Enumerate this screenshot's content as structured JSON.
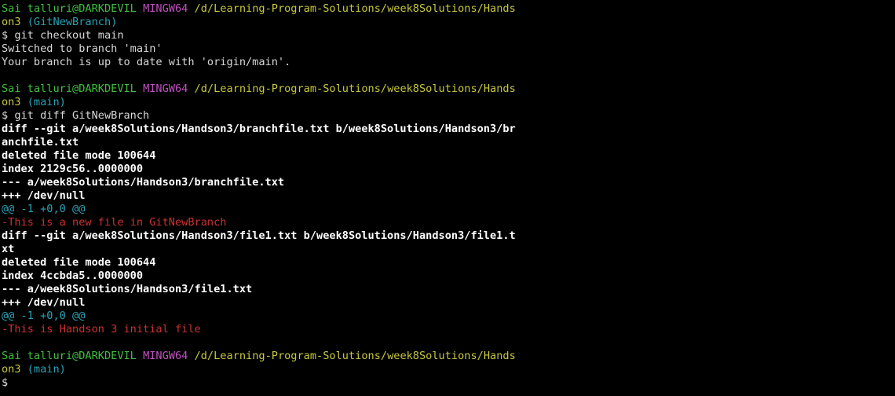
{
  "prompt": {
    "user_host": "Sai talluri@DARKDEVIL",
    "shell": "MINGW64",
    "path_part1": "/d/Learning-Program-Solutions/week8Solutions/Hands",
    "path_part2": "on3"
  },
  "blocks": {
    "b1": {
      "branch": "(GitNewBranch)",
      "command": "$ git checkout main",
      "out1": "Switched to branch 'main'",
      "out2": "Your branch is up to date with 'origin/main'."
    },
    "b2": {
      "branch": "(main)",
      "command": "$ git diff GitNewBranch",
      "diff1_header_a": "diff --git a/week8Solutions/Handson3/branchfile.txt b/week8Solutions/Handson3/br",
      "diff1_header_b": "anchfile.txt",
      "diff1_mode": "deleted file mode 100644",
      "diff1_index": "index 2129c56..0000000",
      "diff1_minus": "--- a/week8Solutions/Handson3/branchfile.txt",
      "diff1_plus": "+++ /dev/null",
      "diff1_hunk": "@@ -1 +0,0 @@",
      "diff1_removed": "-This is a new file in GitNewBranch",
      "diff2_header_a": "diff --git a/week8Solutions/Handson3/file1.txt b/week8Solutions/Handson3/file1.t",
      "diff2_header_b": "xt",
      "diff2_mode": "deleted file mode 100644",
      "diff2_index": "index 4ccbda5..0000000",
      "diff2_minus": "--- a/week8Solutions/Handson3/file1.txt",
      "diff2_plus": "+++ /dev/null",
      "diff2_hunk": "@@ -1 +0,0 @@",
      "diff2_removed": "-This is Handson 3 initial file"
    },
    "b3": {
      "branch": "(main)",
      "command": "$"
    }
  }
}
